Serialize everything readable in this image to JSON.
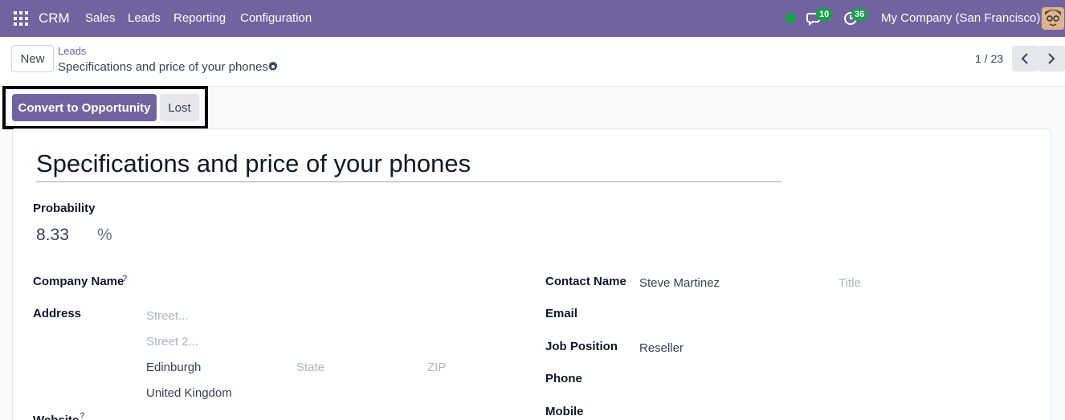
{
  "topbar": {
    "app_name": "CRM",
    "menu": [
      "Sales",
      "Leads",
      "Reporting",
      "Configuration"
    ],
    "messages_count": "10",
    "activities_count": "36",
    "company": "My Company (San Francisco)",
    "accent_color": "#71639e"
  },
  "control_panel": {
    "new_label": "New",
    "breadcrumb_parent": "Leads",
    "breadcrumb_current": "Specifications and price of your phones",
    "pager": "1 / 23"
  },
  "actions": {
    "convert_label": "Convert to Opportunity",
    "lost_label": "Lost"
  },
  "form": {
    "title": "Specifications and price of your phones",
    "probability_label": "Probability",
    "probability_value": "8.33",
    "probability_unit": "%",
    "company_name_label": "Company Name",
    "help_mark": "?",
    "address_label": "Address",
    "street_placeholder": "Street...",
    "street2_placeholder": "Street 2...",
    "city": "Edinburgh",
    "state_placeholder": "State",
    "zip_placeholder": "ZIP",
    "country": "United Kingdom",
    "website_label": "Website",
    "contact_name_label": "Contact Name",
    "contact_name": "Steve Martinez",
    "title_placeholder": "Title",
    "email_label": "Email",
    "job_position_label": "Job Position",
    "job_position": "Reseller",
    "phone_label": "Phone",
    "mobile_label": "Mobile"
  }
}
